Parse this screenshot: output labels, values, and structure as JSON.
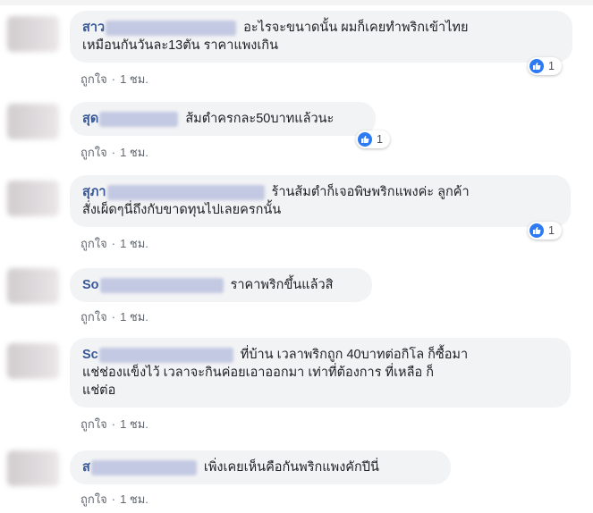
{
  "comments": [
    {
      "name": "สาว",
      "text_line1": "อะไรจะขนาดนั้น ผมก็เคยทำพริกเข้าไทย",
      "text_line2": "เหมือนกันวันละ13ตัน ราคาแพงเกิน",
      "like": "ถูกใจ",
      "time": "1 ชม.",
      "reactions": "1"
    },
    {
      "name": "สุด",
      "text_line1": "ส้มตำครกละ50บาทแล้วนะ",
      "like": "ถูกใจ",
      "time": "1 ชม.",
      "reactions": "1"
    },
    {
      "name": "สุภา",
      "text_line1": "ร้านส้มตำก็เจอพิษพริกแพงค่ะ ลูกค้า",
      "text_line2": "สั่งเผ็ดๆนี่ถึงกับขาดทุนไปเลยครกนั้น",
      "like": "ถูกใจ",
      "time": "1 ชม.",
      "reactions": "1"
    },
    {
      "name": "So",
      "text_line1": "ราคาพริกขึ้นแล้วสิ",
      "like": "ถูกใจ",
      "time": "1 ชม."
    },
    {
      "name": "Sc",
      "text_line1": "ที่บ้าน เวลาพริกถูก 40บาทต่อกิโล ก็ซื้อมา",
      "text_line2": "แช่ช่องแข็งไว้ เวลาจะกินค่อยเอาออกมา เท่าที่ต้องการ ที่เหลือ ก็",
      "text_line3": "แช่ต่อ",
      "like": "ถูกใจ",
      "time": "1 ชม."
    },
    {
      "name": "ส",
      "text_line1": "เพิ่งเคยเห็นคือกันพริกแพงคักปีนี่",
      "like": "ถูกใจ",
      "time": "1 ชม."
    }
  ],
  "meta_separator": "·",
  "colors": {
    "name": "#385898",
    "bubble": "#f2f3f5",
    "like_blue": "#2d7bf4",
    "meta": "#616770"
  },
  "icons": {
    "reaction": "thumbs-up-icon",
    "avatar": "blurred-avatar"
  }
}
